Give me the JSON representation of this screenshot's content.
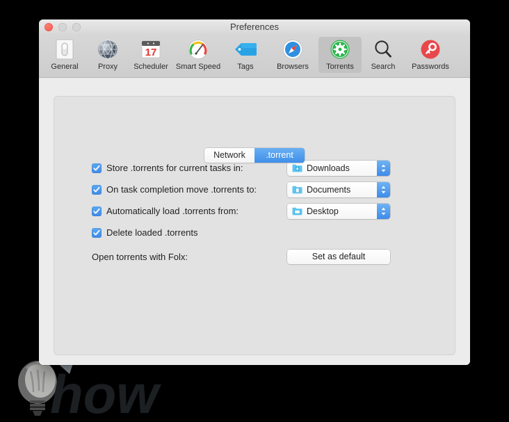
{
  "window": {
    "title": "Preferences",
    "traffic_lights": [
      {
        "name": "close-button",
        "color": "#f9584e"
      },
      {
        "name": "minimize-button",
        "color": "#d6d6d6"
      },
      {
        "name": "maximize-button",
        "color": "#d6d6d6"
      }
    ]
  },
  "toolbar": {
    "items": [
      {
        "label": "General",
        "icon": "switch-icon",
        "selected": false
      },
      {
        "label": "Proxy",
        "icon": "globe-icon",
        "selected": false
      },
      {
        "label": "Scheduler",
        "icon": "calendar-icon",
        "selected": false,
        "calendar_day": "17"
      },
      {
        "label": "Smart Speed",
        "icon": "speedometer-icon",
        "selected": false
      },
      {
        "label": "Tags",
        "icon": "tag-icon",
        "selected": false
      },
      {
        "label": "Browsers",
        "icon": "compass-icon",
        "selected": false
      },
      {
        "label": "Torrents",
        "icon": "gear-icon",
        "selected": true
      },
      {
        "label": "Search",
        "icon": "magnifier-icon",
        "selected": false
      },
      {
        "label": "Passwords",
        "icon": "key-icon",
        "selected": false
      }
    ]
  },
  "tabs": [
    {
      "label": "Network",
      "active": false
    },
    {
      "label": ".torrent",
      "active": true
    }
  ],
  "settings": {
    "rows": [
      {
        "type": "checkbox-popup",
        "checked": true,
        "label": "Store .torrents for current tasks in:",
        "popup_value": "Downloads",
        "popup_icon": "downloads-folder-icon"
      },
      {
        "type": "checkbox-popup",
        "checked": true,
        "label": "On task completion move .torrents to:",
        "popup_value": "Documents",
        "popup_icon": "documents-folder-icon"
      },
      {
        "type": "checkbox-popup",
        "checked": true,
        "label": "Automatically load .torrents from:",
        "popup_value": "Desktop",
        "popup_icon": "desktop-folder-icon"
      },
      {
        "type": "checkbox",
        "checked": true,
        "label": "Delete loaded .torrents"
      },
      {
        "type": "label-button",
        "label": "Open torrents with Folx:",
        "button_label": "Set as default"
      }
    ]
  },
  "watermark": {
    "text": "how",
    "icon": "lightbulb-icon"
  },
  "colors": {
    "accent_blue": "#3f8ae8",
    "tab_active": "#4b93ea",
    "window_bg": "#ececec",
    "panel_bg": "#e2e2e2",
    "toolbar_bg": "#d2d2d2",
    "selected_toolbar_item": "#c2c2c2",
    "torrents_green": "#2cb34a",
    "passwords_red": "#e8474b"
  }
}
